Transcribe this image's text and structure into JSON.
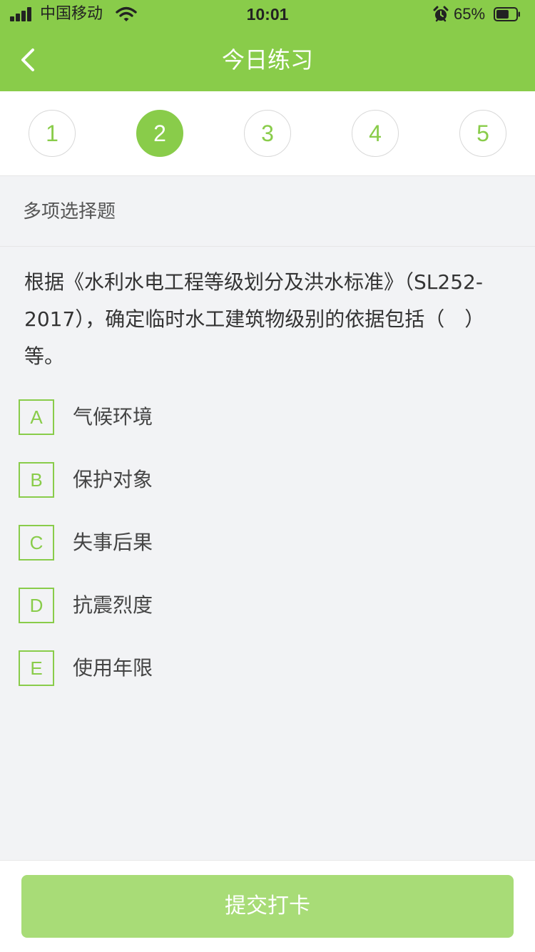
{
  "status_bar": {
    "carrier": "中国移动",
    "time": "10:01",
    "battery_percent": "65%",
    "battery_level": 0.65,
    "icons": [
      "signal-icon",
      "wifi-icon",
      "alarm-icon",
      "battery-icon"
    ]
  },
  "nav": {
    "title": "今日练习",
    "back_icon": "chevron-left-icon"
  },
  "steps": {
    "items": [
      "1",
      "2",
      "3",
      "4",
      "5"
    ],
    "active": "2"
  },
  "question": {
    "type": "多项选择题",
    "text": "根据《水利水电工程等级划分及洪水标准》（SL252-2017），确定临时水工建筑物级别的依据包括（　）等。",
    "options": [
      {
        "letter": "A",
        "text": "气候环境"
      },
      {
        "letter": "B",
        "text": "保护对象"
      },
      {
        "letter": "C",
        "text": "失事后果"
      },
      {
        "letter": "D",
        "text": "抗震烈度"
      },
      {
        "letter": "E",
        "text": "使用年限"
      }
    ]
  },
  "footer": {
    "submit_label": "提交打卡"
  },
  "colors": {
    "accent": "#89cc4a",
    "button": "#a8dc77",
    "background": "#f2f3f5"
  }
}
